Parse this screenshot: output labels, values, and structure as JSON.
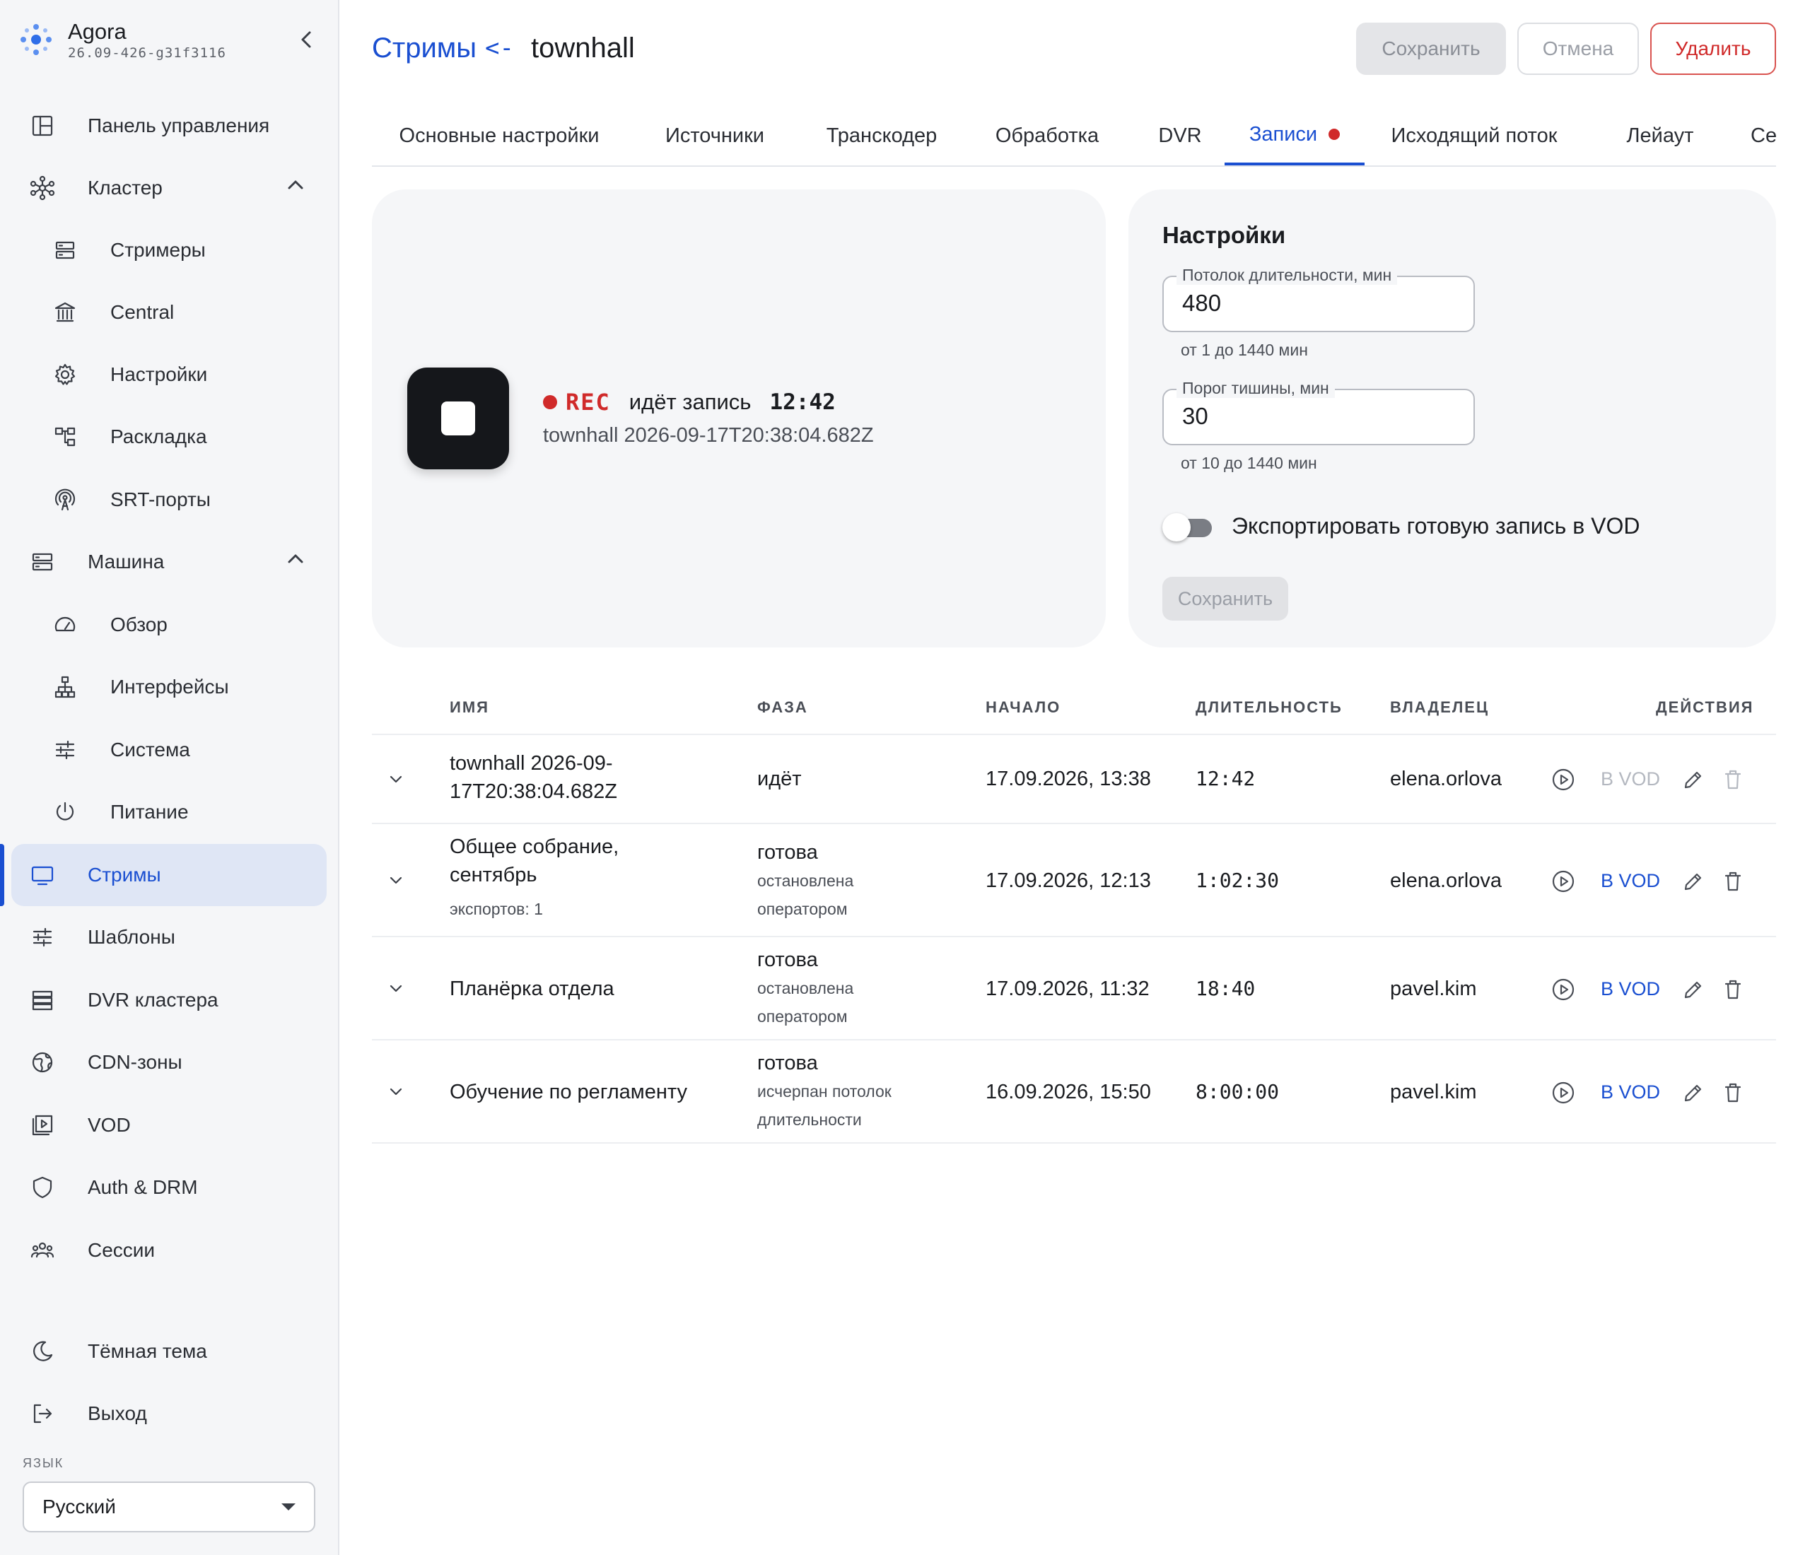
{
  "app": {
    "name": "Agora",
    "version": "26.09-426-g31f3116"
  },
  "sidebar": {
    "items": [
      {
        "label": "Панель управления",
        "icon": "dashboard-icon"
      },
      {
        "label": "Кластер",
        "icon": "cluster-icon",
        "expanded": true
      },
      {
        "label": "Стримеры",
        "icon": "server-icon"
      },
      {
        "label": "Central",
        "icon": "bank-icon"
      },
      {
        "label": "Настройки",
        "icon": "gear-icon"
      },
      {
        "label": "Раскладка",
        "icon": "layout-tree-icon"
      },
      {
        "label": "SRT-порты",
        "icon": "antenna-icon"
      },
      {
        "label": "Машина",
        "icon": "machine-icon",
        "expanded": true
      },
      {
        "label": "Обзор",
        "icon": "gauge-icon"
      },
      {
        "label": "Интерфейсы",
        "icon": "network-icon"
      },
      {
        "label": "Система",
        "icon": "sliders-icon"
      },
      {
        "label": "Питание",
        "icon": "power-icon"
      },
      {
        "label": "Стримы",
        "icon": "monitor-icon",
        "active": true
      },
      {
        "label": "Шаблоны",
        "icon": "sliders-icon"
      },
      {
        "label": "DVR кластера",
        "icon": "storage-icon"
      },
      {
        "label": "CDN-зоны",
        "icon": "globe-icon"
      },
      {
        "label": "VOD",
        "icon": "video-library-icon"
      },
      {
        "label": "Auth & DRM",
        "icon": "shield-icon"
      },
      {
        "label": "Сессии",
        "icon": "users-icon"
      }
    ],
    "theme_toggle": "Тёмная тема",
    "logout": "Выход",
    "language_label": "ЯЗЫК",
    "language_value": "Русский"
  },
  "header": {
    "breadcrumb_link": "Стримы",
    "breadcrumb_arrow": "<-",
    "title": "townhall",
    "save_label": "Сохранить",
    "cancel_label": "Отмена",
    "delete_label": "Удалить"
  },
  "tabs": [
    {
      "label": "Основные настройки"
    },
    {
      "label": "Источники"
    },
    {
      "label": "Транскодер"
    },
    {
      "label": "Обработка"
    },
    {
      "label": "DVR"
    },
    {
      "label": "Записи",
      "active": true,
      "indicator": true
    },
    {
      "label": "Исходящий поток"
    },
    {
      "label": "Лейаут"
    },
    {
      "label": "Сессии"
    }
  ],
  "recording": {
    "rec_label": "REC",
    "status": "идёт запись",
    "elapsed": "12:42",
    "name": "townhall 2026-09-17T20:38:04.682Z"
  },
  "settings": {
    "title": "Настройки",
    "duration_cap": {
      "label": "Потолок длительности, мин",
      "value": "480",
      "hint": "от 1 до 1440 мин"
    },
    "silence_threshold": {
      "label": "Порог тишины, мин",
      "value": "30",
      "hint": "от 10 до 1440 мин"
    },
    "export_vod": {
      "label": "Экспортировать готовую запись в VOD",
      "enabled": false
    },
    "save_label": "Сохранить"
  },
  "table": {
    "columns": [
      "ИМЯ",
      "ФАЗА",
      "НАЧАЛО",
      "ДЛИТЕЛЬНОСТЬ",
      "ВЛАДЕЛЕЦ",
      "ДЕЙСТВИЯ"
    ],
    "vod_label": "В VOD",
    "rows": [
      {
        "name": "townhall 2026-09-17T20:38:04.682Z",
        "name_line1": "townhall 2026-09-",
        "name_line2": "17T20:38:04.682Z",
        "exports": "",
        "phase": "идёт",
        "phase_note_1": "",
        "phase_note_2": "",
        "start": "17.09.2026, 13:38",
        "duration": "12:42",
        "owner": "elena.orlova",
        "vod_enabled": false
      },
      {
        "name": "Общее собрание, сентябрь",
        "name_line1": "Общее собрание,",
        "name_line2": "сентябрь",
        "exports": "экспортов: 1",
        "phase": "готова",
        "phase_note_1": "остановлена",
        "phase_note_2": "оператором",
        "start": "17.09.2026, 12:13",
        "duration": "1:02:30",
        "owner": "elena.orlova",
        "vod_enabled": true
      },
      {
        "name": "Планёрка отдела",
        "name_line1": "Планёрка отдела",
        "name_line2": "",
        "exports": "",
        "phase": "готова",
        "phase_note_1": "остановлена",
        "phase_note_2": "оператором",
        "start": "17.09.2026, 11:32",
        "duration": "18:40",
        "owner": "pavel.kim",
        "vod_enabled": true
      },
      {
        "name": "Обучение по регламенту",
        "name_line1": "Обучение по регламенту",
        "name_line2": "",
        "exports": "",
        "phase": "готова",
        "phase_note_1": "исчерпан потолок",
        "phase_note_2": "длительности",
        "start": "16.09.2026, 15:50",
        "duration": "8:00:00",
        "owner": "pavel.kim",
        "vod_enabled": true
      }
    ]
  },
  "colors": {
    "accent": "#1a4fd1",
    "danger": "#d02a2a",
    "sidebar_bg": "#f5f6f8",
    "active_nav_bg": "#dfe6f5"
  }
}
